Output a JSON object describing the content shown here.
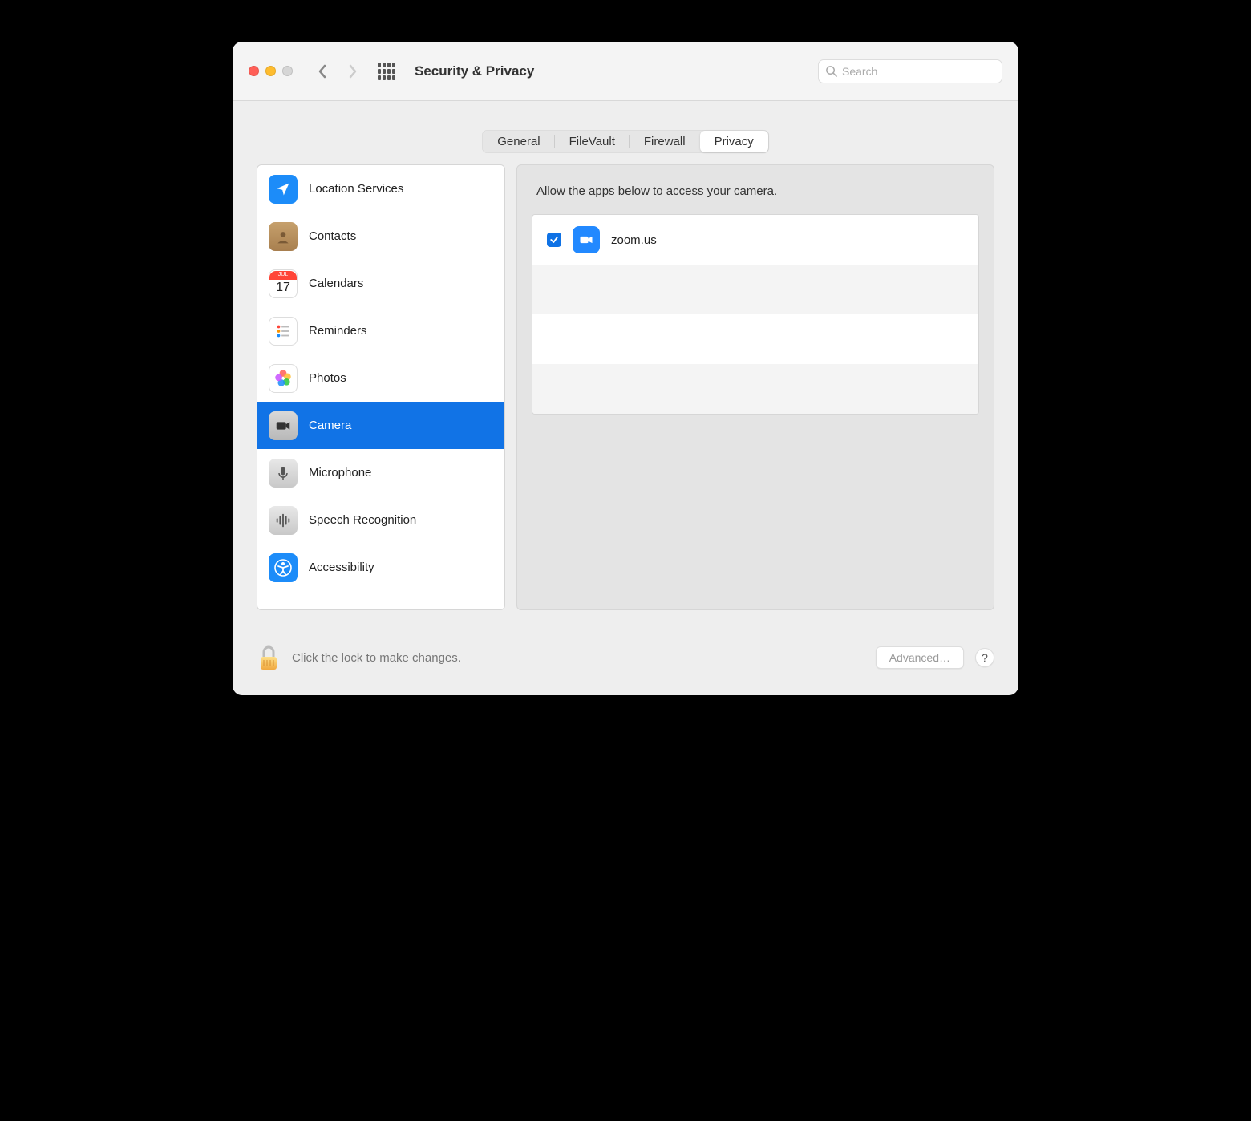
{
  "window": {
    "title": "Security & Privacy"
  },
  "search": {
    "placeholder": "Search"
  },
  "tabs": [
    {
      "label": "General"
    },
    {
      "label": "FileVault"
    },
    {
      "label": "Firewall"
    },
    {
      "label": "Privacy"
    }
  ],
  "sidebar": {
    "items": [
      {
        "label": "Location Services",
        "icon": "location"
      },
      {
        "label": "Contacts",
        "icon": "contacts"
      },
      {
        "label": "Calendars",
        "icon": "calendar",
        "cal_month": "JUL",
        "cal_day": "17"
      },
      {
        "label": "Reminders",
        "icon": "reminders"
      },
      {
        "label": "Photos",
        "icon": "photos"
      },
      {
        "label": "Camera",
        "icon": "camera"
      },
      {
        "label": "Microphone",
        "icon": "microphone"
      },
      {
        "label": "Speech Recognition",
        "icon": "speech"
      },
      {
        "label": "Accessibility",
        "icon": "accessibility"
      }
    ]
  },
  "main": {
    "heading": "Allow the apps below to access your camera.",
    "apps": [
      {
        "name": "zoom.us",
        "checked": true
      }
    ]
  },
  "footer": {
    "lock_text": "Click the lock to make changes.",
    "advanced": "Advanced…",
    "help": "?"
  }
}
